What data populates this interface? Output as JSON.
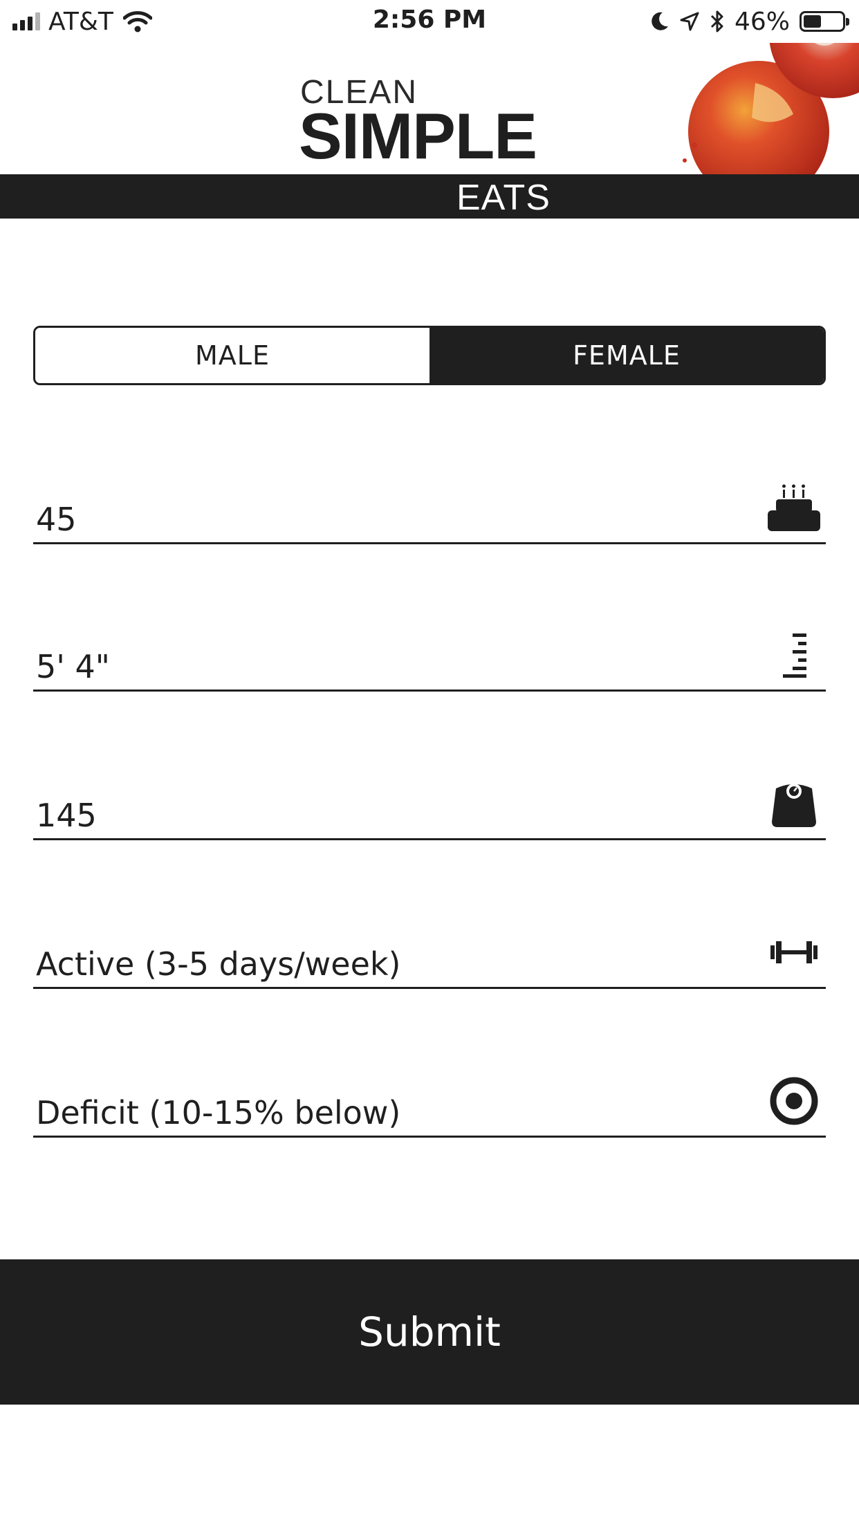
{
  "status_bar": {
    "carrier": "AT&T",
    "time": "2:56 PM",
    "battery_percent": "46%",
    "battery_level": 0.46,
    "icons": [
      "signal-icon",
      "wifi-icon",
      "moon-icon",
      "location-icon",
      "bluetooth-icon",
      "battery-icon"
    ]
  },
  "header": {
    "logo_line1": "CLEAN",
    "logo_line2": "SIMPLE",
    "logo_line3": "EATS"
  },
  "gender": {
    "options": [
      "MALE",
      "FEMALE"
    ],
    "selected": "FEMALE"
  },
  "fields": {
    "age": {
      "value": "45",
      "icon": "cake-icon"
    },
    "height": {
      "value": "5' 4\"",
      "icon": "ruler-icon"
    },
    "weight": {
      "value": "145",
      "icon": "scale-icon"
    },
    "activity": {
      "value": "Active (3-5 days/week)",
      "icon": "dumbbell-icon"
    },
    "goal": {
      "value": "Deficit (10-15% below)",
      "icon": "target-icon"
    }
  },
  "submit_label": "Submit",
  "colors": {
    "dark": "#1f1f1f",
    "background": "#ffffff",
    "tomato": "#c8321e"
  }
}
